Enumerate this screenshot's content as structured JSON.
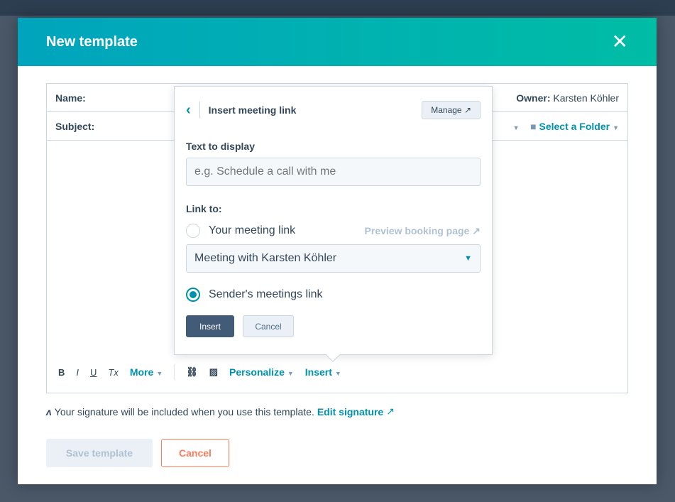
{
  "modal": {
    "title": "New template",
    "close_icon": "close-icon"
  },
  "form": {
    "name_label": "Name:",
    "owner_label": "Owner:",
    "owner_value": "Karsten Köhler",
    "subject_label": "Subject:",
    "folder_label": "Select a Folder"
  },
  "toolbar": {
    "bold": "B",
    "italic": "I",
    "underline": "U",
    "clear": "Tx",
    "more": "More",
    "personalize": "Personalize",
    "insert": "Insert"
  },
  "signature": {
    "text": "Your signature will be included when you use this template.",
    "link": "Edit signature"
  },
  "buttons": {
    "save": "Save template",
    "cancel": "Cancel"
  },
  "popover": {
    "title": "Insert meeting link",
    "manage": "Manage",
    "text_label": "Text to display",
    "text_placeholder": "e.g. Schedule a call with me",
    "link_label": "Link to:",
    "option1": "Your meeting link",
    "preview": "Preview booking page",
    "meeting_select": "Meeting with Karsten Köhler",
    "option2": "Sender's meetings link",
    "selected": "Sender's meetings link",
    "insert": "Insert",
    "cancel": "Cancel"
  },
  "colors": {
    "accent": "#0091ae",
    "header_start": "#00a4bd",
    "header_end": "#00bda5",
    "cancel": "#ff7a59"
  }
}
